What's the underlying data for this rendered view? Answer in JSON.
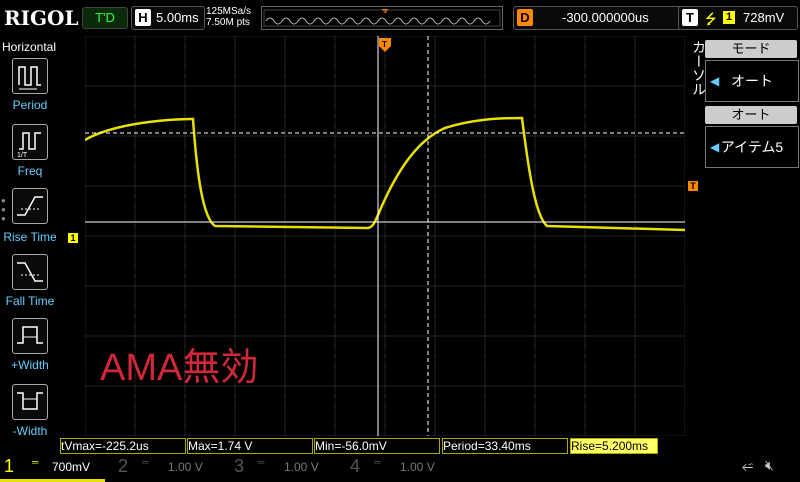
{
  "header": {
    "logo": "RIGOL",
    "run_status": "T'D",
    "horizontal_key": "H",
    "timebase": "5.00ms",
    "sample_rate": "125MSa/s",
    "memory_depth": "7.50M pts",
    "delay_key": "D",
    "delay": "-300.000000us",
    "trigger_key": "T",
    "trigger_source": "1",
    "trigger_level": "728mV"
  },
  "left_menu": {
    "title": "Horizontal",
    "items": [
      {
        "label": "Period",
        "icon": "period-icon"
      },
      {
        "label": "Freq",
        "icon": "frequency-icon"
      },
      {
        "label": "Rise Time",
        "icon": "rise-time-icon"
      },
      {
        "label": "Fall Time",
        "icon": "fall-time-icon"
      },
      {
        "label": "+Width",
        "icon": "positive-width-icon"
      },
      {
        "label": "-Width",
        "icon": "negative-width-icon"
      }
    ]
  },
  "right_menu": {
    "vertical_label": "カーソル",
    "mode_header": "モード",
    "mode_value": "オート",
    "auto_header": "オート",
    "auto_value": "アイテム5"
  },
  "watermark": "AMA無効",
  "channel_marker": "1",
  "trigger_marker": "T",
  "measurements": {
    "tvmax": "tVmax=-225.2us",
    "max": "Max=1.74 V",
    "min": "Min=-56.0mV",
    "period": "Period=33.40ms",
    "rise": "Rise=5.200ms"
  },
  "channels": [
    {
      "num": "1",
      "scale": "700mV",
      "color": "#ffff00",
      "active": true
    },
    {
      "num": "2",
      "scale": "1.00 V",
      "color": "#00ffff",
      "active": false
    },
    {
      "num": "3",
      "scale": "1.00 V",
      "color": "#ff00ff",
      "active": false
    },
    {
      "num": "4",
      "scale": "1.00 V",
      "color": "#3399ff",
      "active": false
    }
  ],
  "colors": {
    "channel1": "#e8e000",
    "watermark": "#d02838",
    "delay_accent": "#ff8800"
  }
}
